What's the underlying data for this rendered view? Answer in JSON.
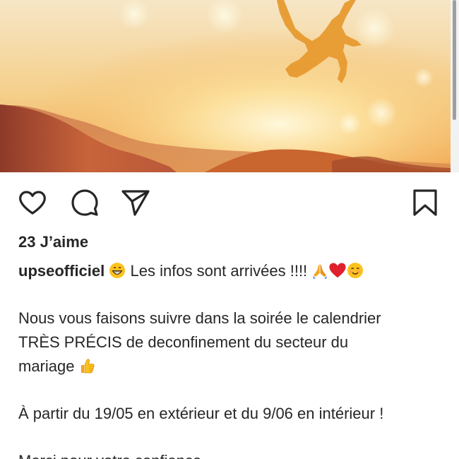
{
  "post": {
    "likes_text": "23 J’aime",
    "username": "upseofficiel",
    "caption_line1": "Les infos sont arrivées !!!!",
    "paragraph1_line1": "Nous vous faisons suivre dans la soirée le calendrier",
    "paragraph1_line2": "TRÈS PRÉCIS de deconfinement du secteur du",
    "paragraph1_line3": "mariage",
    "paragraph2": "À partir du 19/05 en extérieur et du 9/06 en intérieur !",
    "paragraph3": "Merci pour votre confiance"
  },
  "icons": {
    "like": "heart-icon",
    "comment": "comment-bubble-icon",
    "share": "paper-plane-icon",
    "save": "bookmark-icon"
  },
  "colors": {
    "text": "#262626",
    "sky_top": "#f7e7c4",
    "sun_glow": "#fff3c8",
    "hills": "#a04a2c"
  }
}
